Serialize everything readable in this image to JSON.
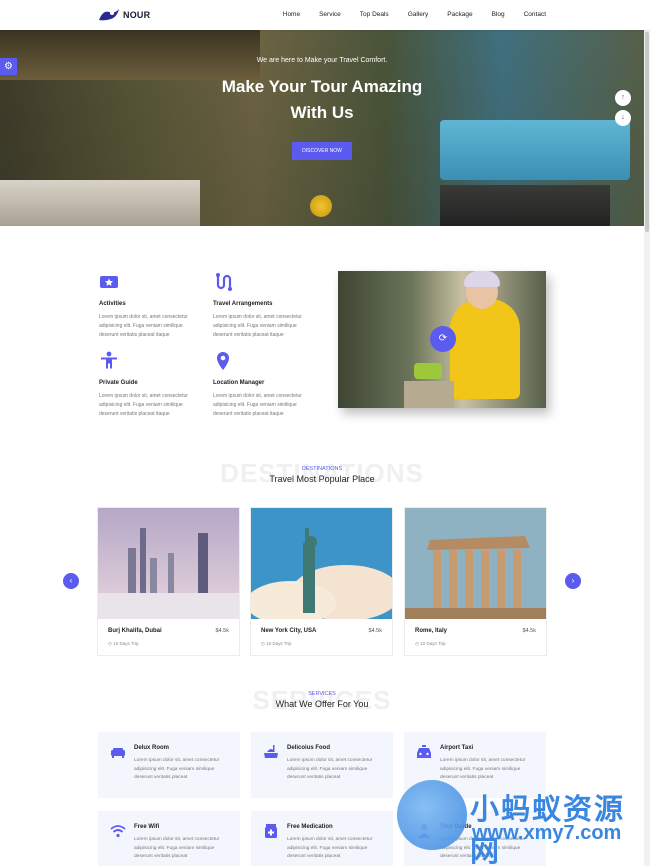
{
  "brand": {
    "name": "NOUR",
    "color": "#5b5bf0"
  },
  "nav": {
    "items": [
      "Home",
      "Service",
      "Top Deals",
      "Gallery",
      "Package",
      "Blog",
      "Contact"
    ]
  },
  "hero": {
    "subtitle": "We are here to Make your Travel Comfort.",
    "title_line1": "Make Your Tour Amazing",
    "title_line2": "With Us",
    "button": "DISCOVER NOW",
    "arrows": [
      "up-arrow-icon",
      "down-arrow-icon"
    ]
  },
  "features": [
    {
      "icon": "ticket-star-icon",
      "title": "Activities",
      "text": [
        "Lorem ipsum dolor sit, amet consectetur",
        "adipisicing elit. Fuga veniam similique",
        "deserunt veritatis placeat itaque"
      ]
    },
    {
      "icon": "route-icon",
      "title": "Travel Arrangements",
      "text": [
        "Lorem ipsum dolor sit, amet consectetur",
        "adipisicing elit. Fuga veniam similique",
        "deserunt veritatis placeat itaque"
      ]
    },
    {
      "icon": "person-icon",
      "title": "Private Guide",
      "text": [
        "Lorem ipsum dolor sit, amet consectetur",
        "adipisicing elit. Fuga veniam similique",
        "deserunt veritatis placeat itaque"
      ]
    },
    {
      "icon": "location-pin-icon",
      "title": "Location Manager",
      "text": [
        "Lorem ipsum dolor sit, amet consectetur",
        "adipisicing elit. Fuga veniam similique",
        "deserunt veritatis placeat itaque"
      ]
    }
  ],
  "destinations": {
    "watermark": "DESTINATIONS",
    "tag": "DESTINATIONS",
    "title": "Travel Most Popular Place",
    "cards": [
      {
        "name": "Burj Khalifa, Dubai",
        "price": "$4.5k",
        "trip": "10 Days Trip"
      },
      {
        "name": "New York City, USA",
        "price": "$4.5k",
        "trip": "10 Days Trip"
      },
      {
        "name": "Rome, Italy",
        "price": "$4.5k",
        "trip": "10 Days Trip"
      }
    ]
  },
  "services": {
    "watermark": "SERVICES",
    "tag": "SERVICES",
    "title": "What We Offer For You",
    "cards": [
      {
        "icon": "sofa-icon",
        "title": "Delux Room",
        "text": [
          "Lorem ipsum dolor sit, amet consectetur",
          "adipisicing elit. Fuga veniam similique",
          "deserunt veritatis placeat"
        ]
      },
      {
        "icon": "food-icon",
        "title": "Delicoius Food",
        "text": [
          "Lorem ipsum dolor sit, amet consectetur",
          "adipisicing elit. Fuga veniam similique",
          "deserunt veritatis placeat"
        ]
      },
      {
        "icon": "taxi-icon",
        "title": "Airport Taxi",
        "text": [
          "Lorem ipsum dolor sit, amet consectetur",
          "adipisicing elit. Fuga veniam similique",
          "deserunt veritatis placeat"
        ]
      },
      {
        "icon": "wifi-icon",
        "title": "Free Wifi",
        "text": [
          "Lorem ipsum dolor sit, amet consectetur",
          "adipisicing elit. Fuga veniam similique",
          "deserunt veritatis placeat"
        ]
      },
      {
        "icon": "medication-icon",
        "title": "Free Medication",
        "text": [
          "Lorem ipsum dolor sit, amet consectetur",
          "adipisicing elit. Fuga veniam similique",
          "deserunt veritatis placeat"
        ]
      },
      {
        "icon": "guide-icon",
        "title": "Tour Guide",
        "text": [
          "Lorem ipsum dolor sit, amet consectetur",
          "adipisicing elit. Fuga veniam similique",
          "deserunt veritatis placeat"
        ]
      }
    ]
  },
  "overlay_watermark": {
    "chinese": "小蚂蚁资源网",
    "url": "www.xmy7.com"
  }
}
